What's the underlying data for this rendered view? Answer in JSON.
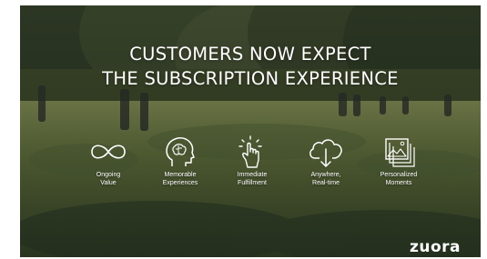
{
  "headline": {
    "line1": "CUSTOMERS NOW EXPECT",
    "line2": "THE SUBSCRIPTION EXPERIENCE"
  },
  "features": [
    {
      "icon": "infinity-icon",
      "line1": "Ongoing",
      "line2": "Value"
    },
    {
      "icon": "head-brain-icon",
      "line1": "Memorable",
      "line2": "Experiences"
    },
    {
      "icon": "hand-tap-icon",
      "line1": "Immediate",
      "line2": "Fulfillment"
    },
    {
      "icon": "cloud-download-icon",
      "line1": "Anywhere,",
      "line2": "Real-time"
    },
    {
      "icon": "photo-stack-icon",
      "line1": "Personalized",
      "line2": "Moments"
    }
  ],
  "logo": {
    "text": "zuora"
  },
  "colors": {
    "text": "#ffffff",
    "sky": "#c9cdbd",
    "trees": "#2f3a25",
    "meadow": "#6b7a45",
    "grass": "#3f5530"
  }
}
